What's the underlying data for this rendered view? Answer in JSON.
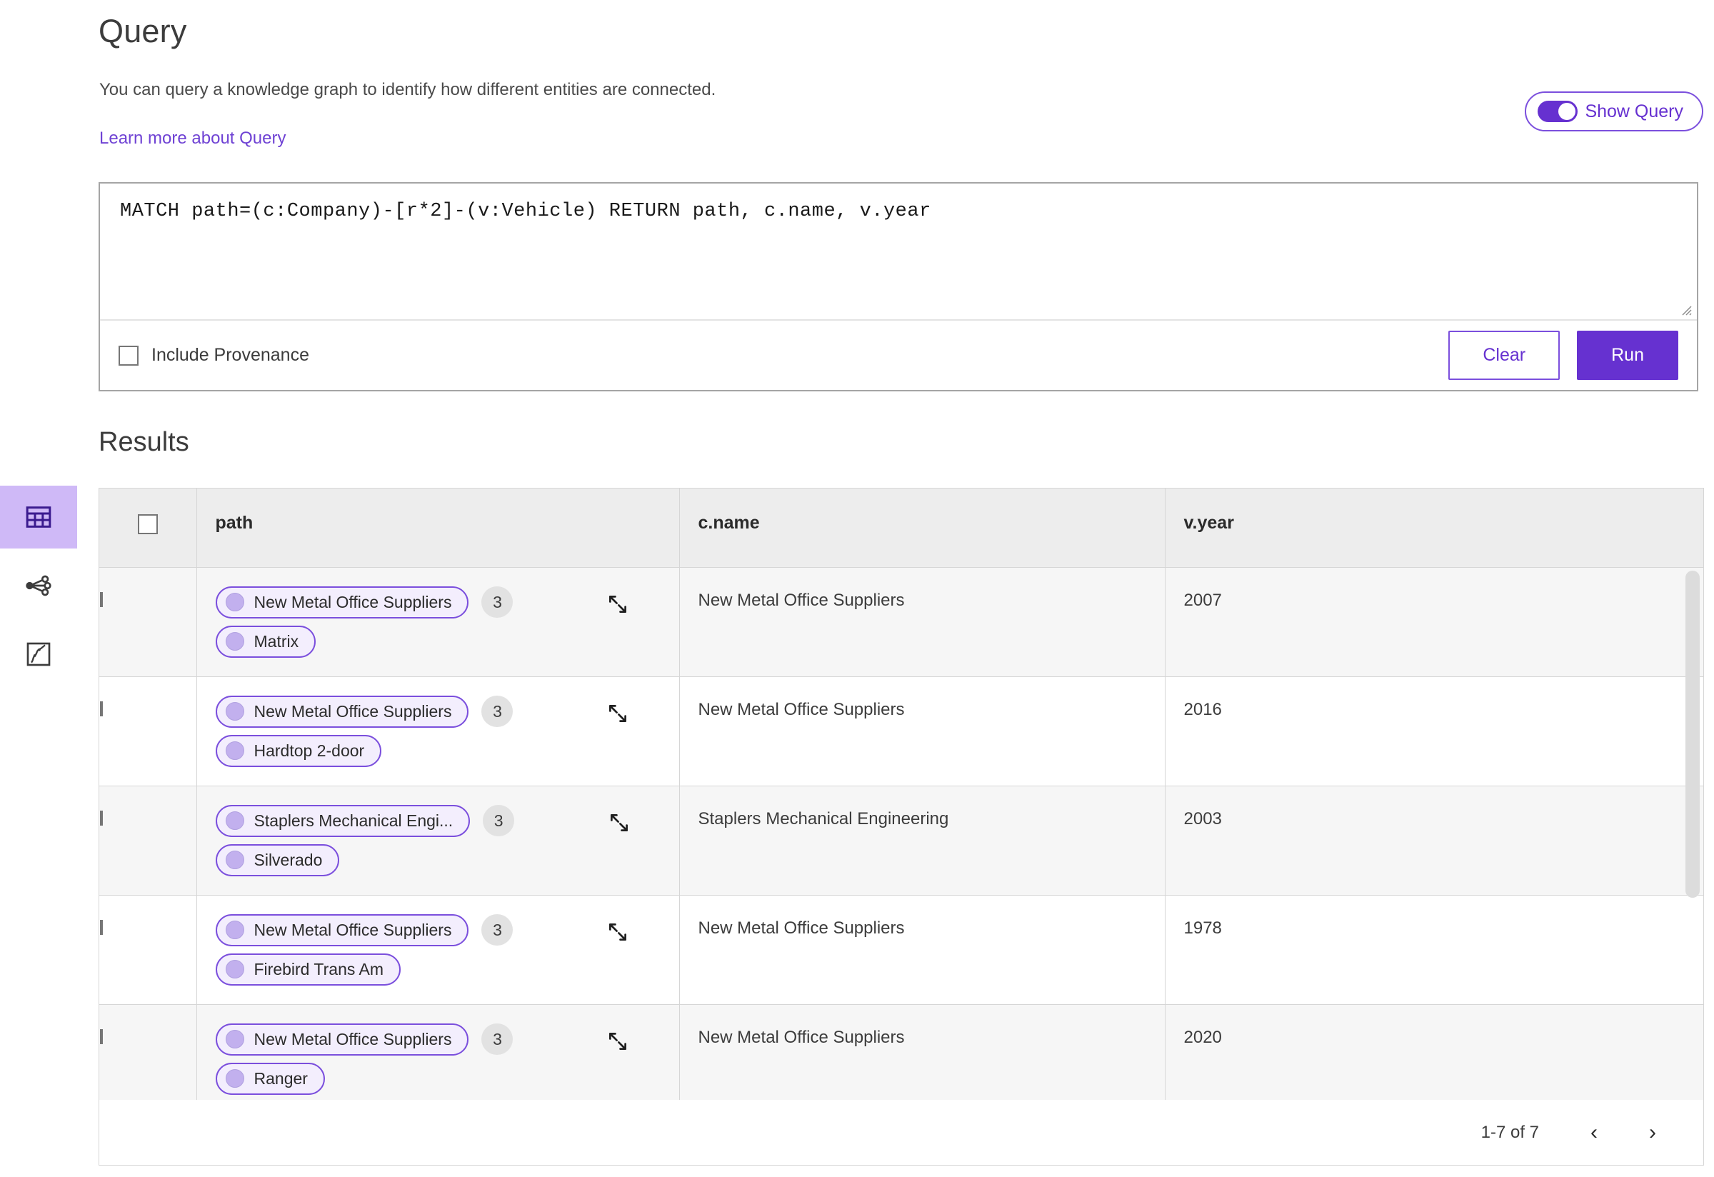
{
  "header": {
    "title": "Query",
    "subtitle": "You can query a knowledge graph to identify how different entities are connected.",
    "learn_more": "Learn more about Query"
  },
  "show_query_toggle": {
    "label": "Show Query",
    "state": "on",
    "accent": "#6631d0"
  },
  "query_editor": {
    "value": "MATCH path=(c:Company)-[r*2]-(v:Vehicle) RETURN path, c.name, v.year",
    "placeholder": "Enter a query"
  },
  "query_actions": {
    "include_provenance_label": "Include Provenance",
    "include_provenance_checked": false,
    "clear_label": "Clear",
    "run_label": "Run"
  },
  "results": {
    "title": "Results",
    "columns": [
      "path",
      "c.name",
      "v.year"
    ],
    "rows": [
      {
        "selected": false,
        "chips": [
          "New Metal Office Suppliers",
          "Matrix"
        ],
        "count": "3",
        "c_name": "New Metal Office Suppliers",
        "v_year": "2007"
      },
      {
        "selected": false,
        "chips": [
          "New Metal Office Suppliers",
          "Hardtop 2-door"
        ],
        "count": "3",
        "c_name": "New Metal Office Suppliers",
        "v_year": "2016"
      },
      {
        "selected": false,
        "chips": [
          "Staplers Mechanical Engi...",
          "Silverado"
        ],
        "count": "3",
        "c_name": "Staplers Mechanical Engineering",
        "v_year": "2003"
      },
      {
        "selected": false,
        "chips": [
          "New Metal Office Suppliers",
          "Firebird Trans Am"
        ],
        "count": "3",
        "c_name": "New Metal Office Suppliers",
        "v_year": "1978"
      },
      {
        "selected": false,
        "chips": [
          "New Metal Office Suppliers",
          "Ranger"
        ],
        "count": "3",
        "c_name": "New Metal Office Suppliers",
        "v_year": "2020"
      }
    ],
    "pagination": {
      "range": "1-7 of 7",
      "prev": "‹",
      "next": "›"
    }
  },
  "sidebar": {
    "items": [
      {
        "icon": "table-icon",
        "active": true
      },
      {
        "icon": "graph-network-icon",
        "active": false
      },
      {
        "icon": "map-icon",
        "active": false
      }
    ]
  }
}
